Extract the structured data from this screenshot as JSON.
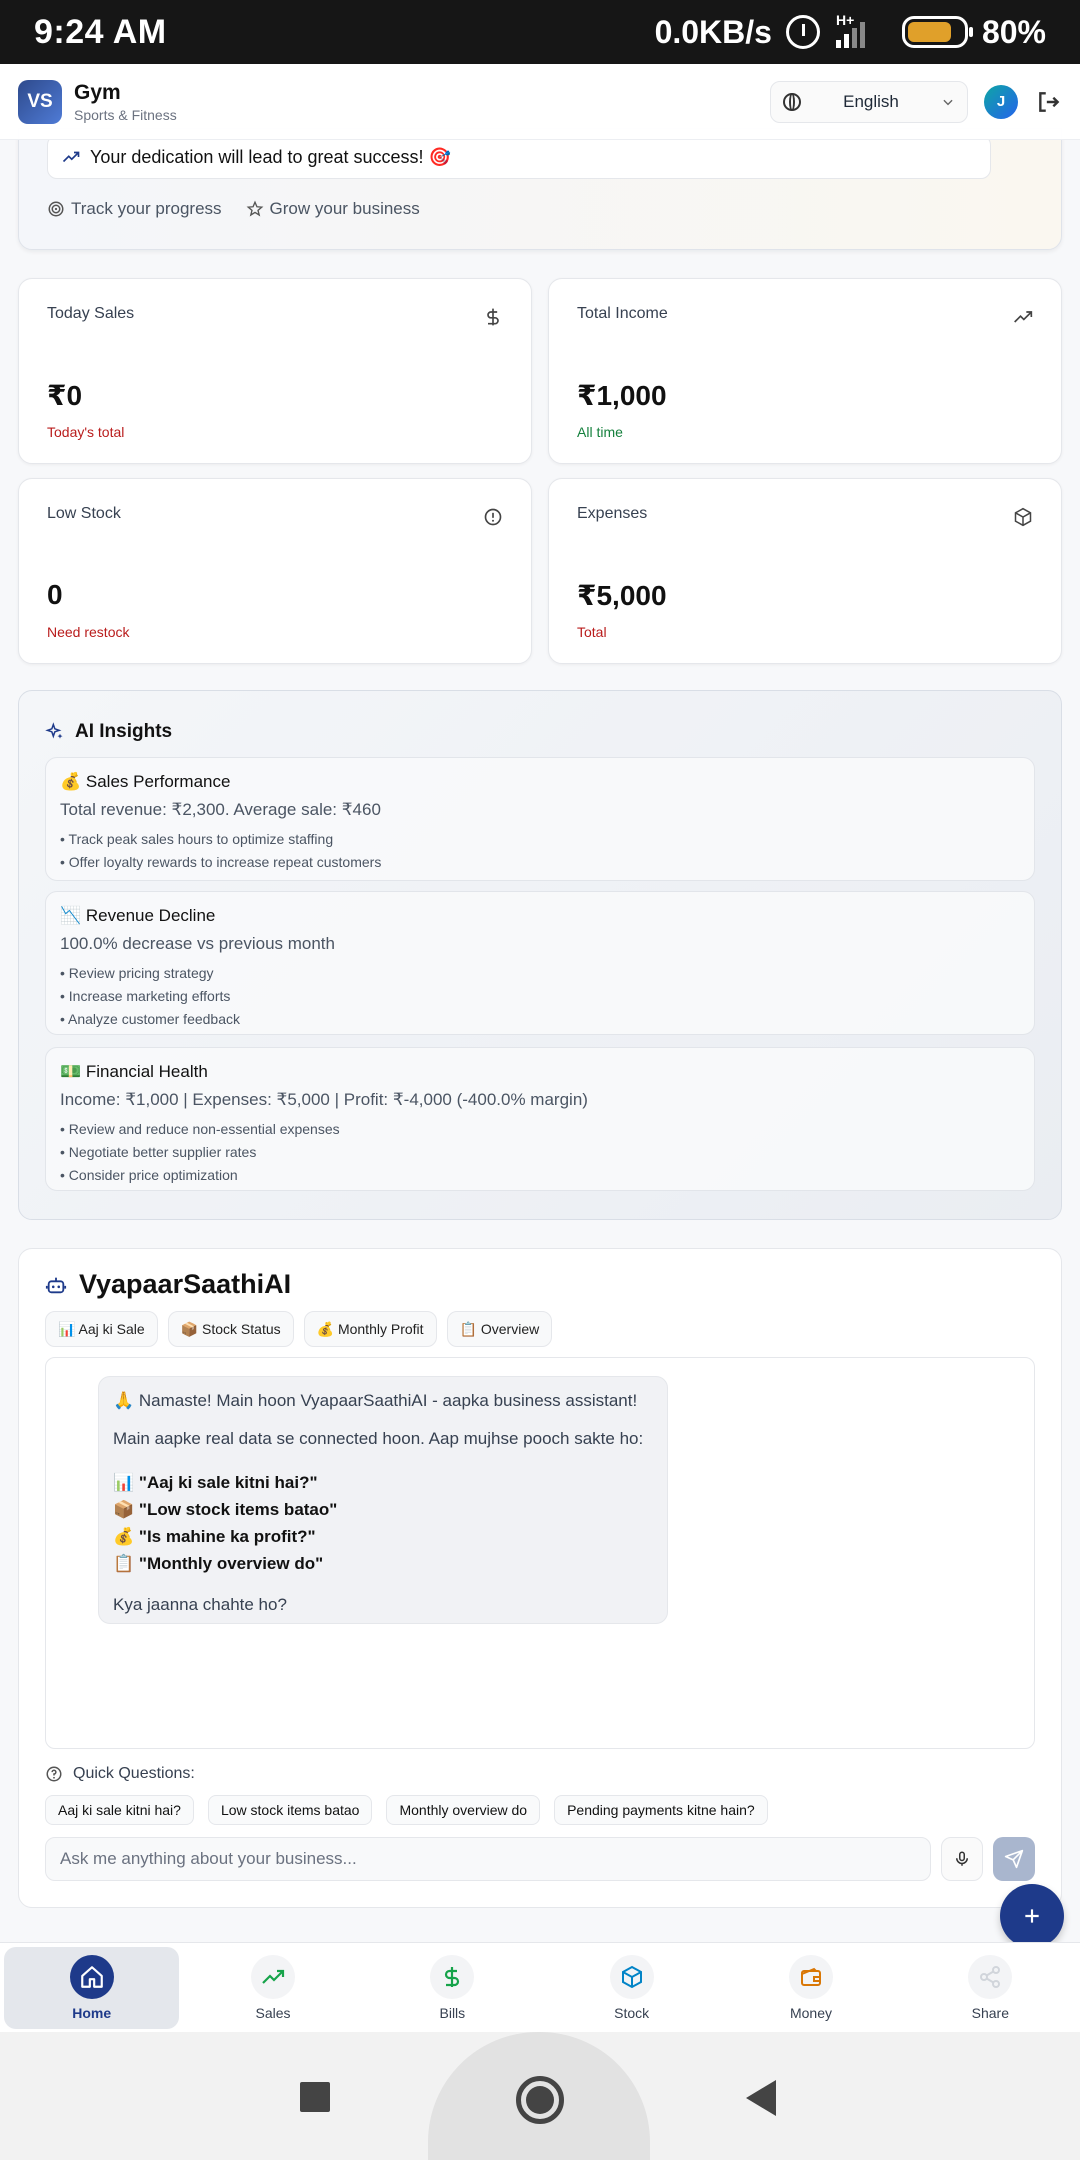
{
  "status_bar": {
    "time": "9:24 AM",
    "network_speed": "0.0KB/s",
    "network_type": "H+",
    "battery": "80%"
  },
  "header": {
    "logo_initials": "VS",
    "business_name": "Gym",
    "business_category": "Sports & Fitness",
    "language": "English",
    "avatar_initial": "J"
  },
  "hero": {
    "quote": "Your dedication will lead to great success! 🎯",
    "pills": [
      "Track your progress",
      "Grow your business"
    ]
  },
  "stats": [
    {
      "title": "Today Sales",
      "value": "₹0",
      "note": "Today's total",
      "icon": "dollar-icon",
      "note_color": "#b91c1c"
    },
    {
      "title": "Total Income",
      "value": "₹1,000",
      "note": "All time",
      "icon": "trending-up-icon",
      "note_color": "#15803d"
    },
    {
      "title": "Low Stock",
      "value": "0",
      "note": "Need restock",
      "icon": "alert-circle-icon",
      "note_color": "#b91c1c"
    },
    {
      "title": "Expenses",
      "value": "₹5,000",
      "note": "Total",
      "icon": "box-icon",
      "note_color": "#b91c1c"
    }
  ],
  "insights": {
    "title": "AI Insights",
    "cards": [
      {
        "title": "💰 Sales Performance",
        "desc": "Total revenue: ₹2,300. Average sale: ₹460",
        "points": [
          "• Track peak sales hours to optimize staffing",
          "• Offer loyalty rewards to increase repeat customers"
        ]
      },
      {
        "title": "📉 Revenue Decline",
        "desc": "100.0% decrease vs previous month",
        "points": [
          "• Review pricing strategy",
          "• Increase marketing efforts",
          "• Analyze customer feedback"
        ]
      },
      {
        "title": "💵 Financial Health",
        "desc": "Income: ₹1,000 | Expenses: ₹5,000 | Profit: ₹-4,000 (-400.0% margin)",
        "points": [
          "• Review and reduce non-essential expenses",
          "• Negotiate better supplier rates",
          "• Consider price optimization"
        ]
      }
    ]
  },
  "assistant": {
    "title": "VyapaarSaathiAI",
    "chips": [
      "📊 Aaj ki Sale",
      "📦 Stock Status",
      "💰 Monthly Profit",
      "📋 Overview"
    ],
    "message": {
      "greeting": "🙏 Namaste! Main hoon VyapaarSaathiAI - aapka business assistant!",
      "intro": "Main aapke real data se connected hoon. Aap mujhse pooch sakte ho:",
      "suggestions": [
        "📊 \"Aaj ki sale kitni hai?\"",
        "📦 \"Low stock items batao\"",
        "💰 \"Is mahine ka profit?\"",
        "📋 \"Monthly overview do\""
      ],
      "closing": "Kya jaanna chahte ho?"
    },
    "quick_title": "Quick Questions:",
    "quick_questions": [
      "Aaj ki sale kitni hai?",
      "Low stock items batao",
      "Monthly overview do",
      "Pending payments kitne hain?"
    ],
    "input_placeholder": "Ask me anything about your business..."
  },
  "bottom_nav": [
    {
      "label": "Home",
      "icon": "home-icon",
      "color": "#1e3a8a"
    },
    {
      "label": "Sales",
      "icon": "trending-up-icon",
      "color": "#16a34a"
    },
    {
      "label": "Bills",
      "icon": "dollar-icon",
      "color": "#16a34a"
    },
    {
      "label": "Stock",
      "icon": "box-icon",
      "color": "#0284c7"
    },
    {
      "label": "Money",
      "icon": "wallet-icon",
      "color": "#d97706"
    },
    {
      "label": "Share",
      "icon": "share-icon",
      "color": "#9ca3af"
    }
  ]
}
